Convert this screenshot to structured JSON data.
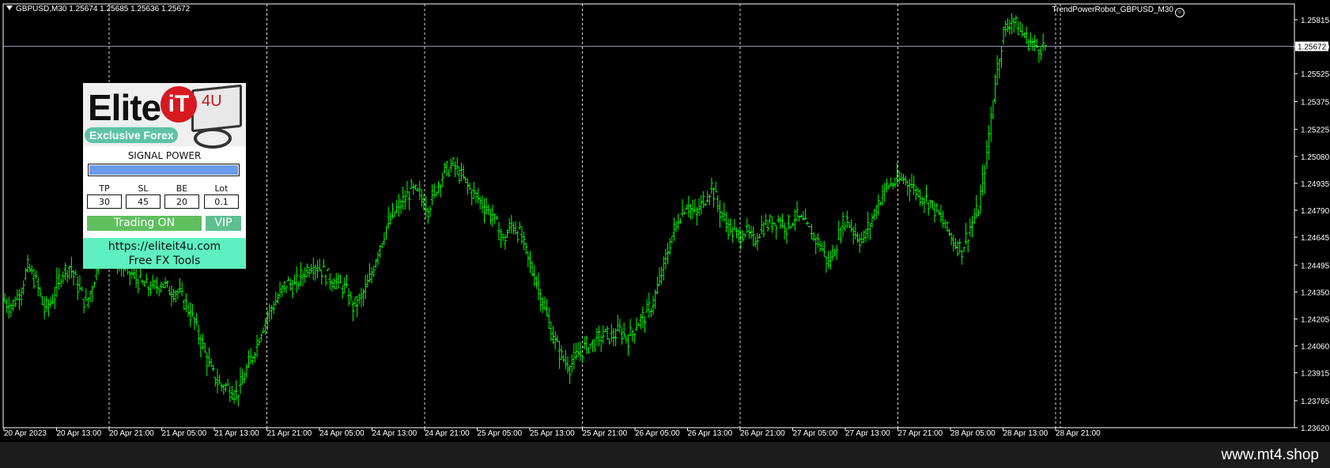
{
  "header": {
    "symbol_text": "GBPUSD,M30  1.25674 1.25685 1.25636 1.25672",
    "ea_name": "TrendPowerRobot_GBPUSD_M30"
  },
  "chart_data": {
    "type": "bar",
    "symbol": "GBPUSD",
    "timeframe": "M30",
    "ohlc_current": {
      "open": 1.25674,
      "high": 1.25685,
      "low": 1.25636,
      "close": 1.25672
    },
    "current_price_label": "1.25672",
    "ylim": [
      1.2362,
      1.259
    ],
    "y_ticks": [
      "1.25815",
      "1.25670",
      "1.25525",
      "1.25375",
      "1.25225",
      "1.25080",
      "1.24935",
      "1.24790",
      "1.24645",
      "1.24495",
      "1.24350",
      "1.24205",
      "1.24060",
      "1.23915",
      "1.23765",
      "1.23620"
    ],
    "x_ticks": [
      "20 Apr 2023",
      "20 Apr 13:00",
      "20 Apr 21:00",
      "21 Apr 05:00",
      "21 Apr 13:00",
      "21 Apr 21:00",
      "24 Apr 05:00",
      "24 Apr 13:00",
      "24 Apr 21:00",
      "25 Apr 05:00",
      "25 Apr 13:00",
      "25 Apr 21:00",
      "26 Apr 05:00",
      "26 Apr 13:00",
      "26 Apr 21:00",
      "27 Apr 05:00",
      "27 Apr 13:00",
      "27 Apr 21:00",
      "28 Apr 05:00",
      "28 Apr 13:00",
      "28 Apr 21:00"
    ],
    "series": [
      {
        "values": [
          1.2431,
          1.2427,
          1.2435,
          1.2448,
          1.244,
          1.2425,
          1.2432,
          1.2445,
          1.2449,
          1.2438,
          1.2428,
          1.2443,
          1.2466,
          1.2458,
          1.245,
          1.2446,
          1.2442,
          1.2438,
          1.2437,
          1.244,
          1.2436,
          1.2435,
          1.2428,
          1.2418,
          1.2405,
          1.2392,
          1.2385,
          1.2384,
          1.238,
          1.239,
          1.2402,
          1.2415,
          1.2425,
          1.2432,
          1.244,
          1.2438,
          1.2445,
          1.245,
          1.2448,
          1.2443,
          1.244,
          1.2437,
          1.2427,
          1.2432,
          1.2442,
          1.2458,
          1.247,
          1.2478,
          1.2484,
          1.249,
          1.2487,
          1.248,
          1.2492,
          1.25,
          1.2503,
          1.2497,
          1.249,
          1.2485,
          1.248,
          1.2473,
          1.2462,
          1.2472,
          1.2466,
          1.2452,
          1.244,
          1.2425,
          1.241,
          1.24,
          1.2395,
          1.2402,
          1.2406,
          1.2408,
          1.2412,
          1.2411,
          1.2414,
          1.241,
          1.2418,
          1.2422,
          1.243,
          1.2445,
          1.2462,
          1.2475,
          1.2483,
          1.2476,
          1.2484,
          1.2492,
          1.2478,
          1.247,
          1.2465,
          1.2468,
          1.2462,
          1.247,
          1.2472,
          1.2474,
          1.247,
          1.2476,
          1.2472,
          1.2466,
          1.246,
          1.245,
          1.2462,
          1.2475,
          1.2468,
          1.2462,
          1.2472,
          1.2484,
          1.2492,
          1.2494,
          1.2496,
          1.2492,
          1.2487,
          1.2484,
          1.2478,
          1.247,
          1.2462,
          1.2458,
          1.247,
          1.248,
          1.251,
          1.255,
          1.2575,
          1.2582,
          1.2575,
          1.257,
          1.2567,
          1.2567
        ]
      }
    ]
  },
  "panel": {
    "logo": {
      "elite": "Elite",
      "it": "iT",
      "four_u": "4U",
      "tagline": "Exclusive Forex"
    },
    "signal_label": "SIGNAL POWER",
    "signal_level": 1.0,
    "fields": [
      {
        "label": "TP",
        "value": "30"
      },
      {
        "label": "SL",
        "value": "45"
      },
      {
        "label": "BE",
        "value": "20"
      },
      {
        "label": "Lot",
        "value": "0.1"
      }
    ],
    "trading_button": "Trading ON",
    "vip_button": "VIP",
    "url": "https://eliteit4u.com",
    "free_tools": "Free FX Tools"
  },
  "colors": {
    "candle": "#00ff00",
    "grid": "#ffffff",
    "axis": "#ffffff",
    "signal_fill": "#6b9bea",
    "trade_btn": "#5fbf5f",
    "vip_btn": "#5fbf8f",
    "link_bg": "#5ef0c0"
  },
  "footer": {
    "brand": "www.mt4.shop"
  }
}
